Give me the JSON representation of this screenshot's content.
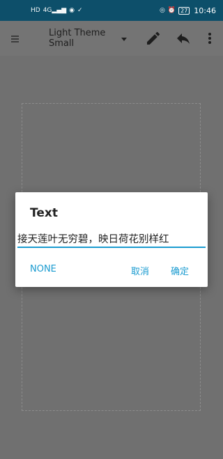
{
  "status_bar": {
    "left_icons": [
      "hd-icon",
      "signal-4g-icon",
      "messenger-icon",
      "check-icon"
    ],
    "hd_label": "HD",
    "network_label": "4G",
    "battery": "27",
    "time": "10:46"
  },
  "toolbar": {
    "theme_line1": "Light Theme",
    "theme_line2": "Small"
  },
  "dialog": {
    "title": "Text",
    "input_value": "接天莲叶无穷碧，映日荷花别样红",
    "none_label": "NONE",
    "cancel_label": "取消",
    "ok_label": "确定"
  },
  "colors": {
    "status_bar": "#0d4f6a",
    "accent": "#1a9bd0",
    "scrim": "#6e6e6e"
  }
}
